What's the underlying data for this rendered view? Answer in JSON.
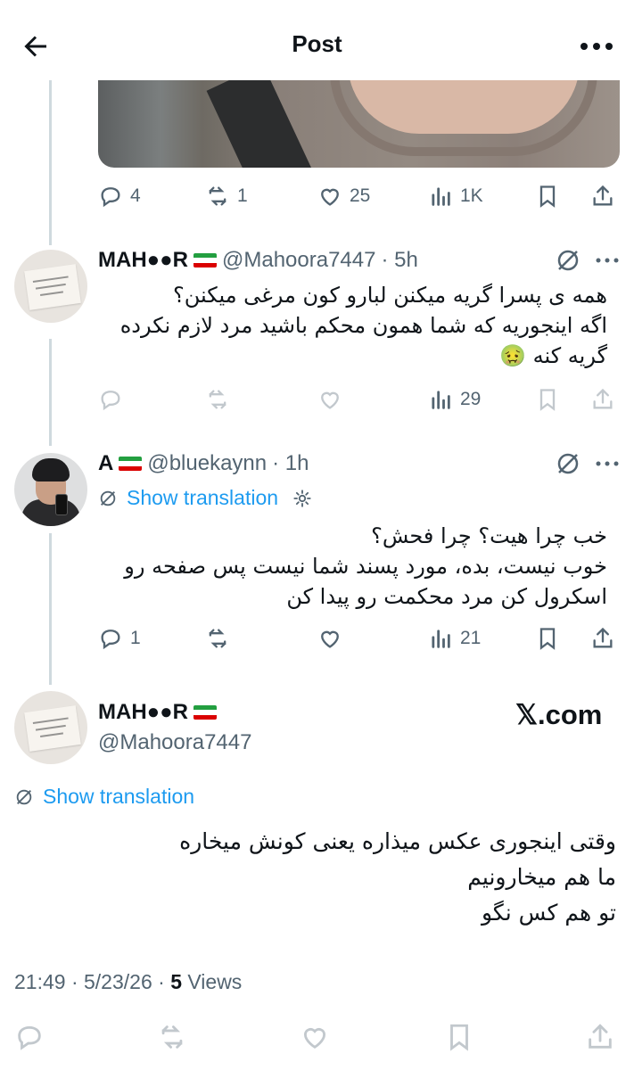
{
  "header": {
    "title": "Post"
  },
  "top_post": {
    "actions": {
      "replies": "4",
      "reposts": "1",
      "likes": "25",
      "views": "1K"
    }
  },
  "reply1": {
    "name": "MAH●●R",
    "handle": "@Mahoora7447",
    "time": "· 5h",
    "text_lines": [
      "همه ی پسرا گریه میکنن لبارو کون مرغی میکنن؟",
      "اگه اینجوریه که شما همون محکم باشید مرد لازم نکرده",
      "گریه کنه 🤢"
    ],
    "actions": {
      "views": "29"
    }
  },
  "reply2": {
    "name": "A",
    "handle": "@bluekaynn",
    "time": "· 1h",
    "translation_label": "Show translation",
    "text_lines": [
      "خب چرا هیت؟ چرا فحش؟",
      "خوب نیست، بده، مورد پسند شما نیست پس صفحه رو",
      "اسکرول کن مرد محکمت رو پیدا کن"
    ],
    "actions": {
      "replies": "1",
      "views": "21"
    }
  },
  "main_post": {
    "name": "MAH●●R",
    "handle": "@Mahoora7447",
    "watermark": "𝕏.com",
    "translation_label": "Show translation",
    "text_lines": [
      "وقتی اینجوری عکس میذاره یعنی کونش میخاره",
      "ما هم میخارونیم",
      "تو هم کس نگو"
    ],
    "timestamp": "21:49 · 5/23/26 · ",
    "views_count": "5",
    "views_label": " Views"
  },
  "colors": {
    "accent": "#1d9bf0",
    "secondary_text": "#536471",
    "thread_line": "#cfd9de"
  }
}
